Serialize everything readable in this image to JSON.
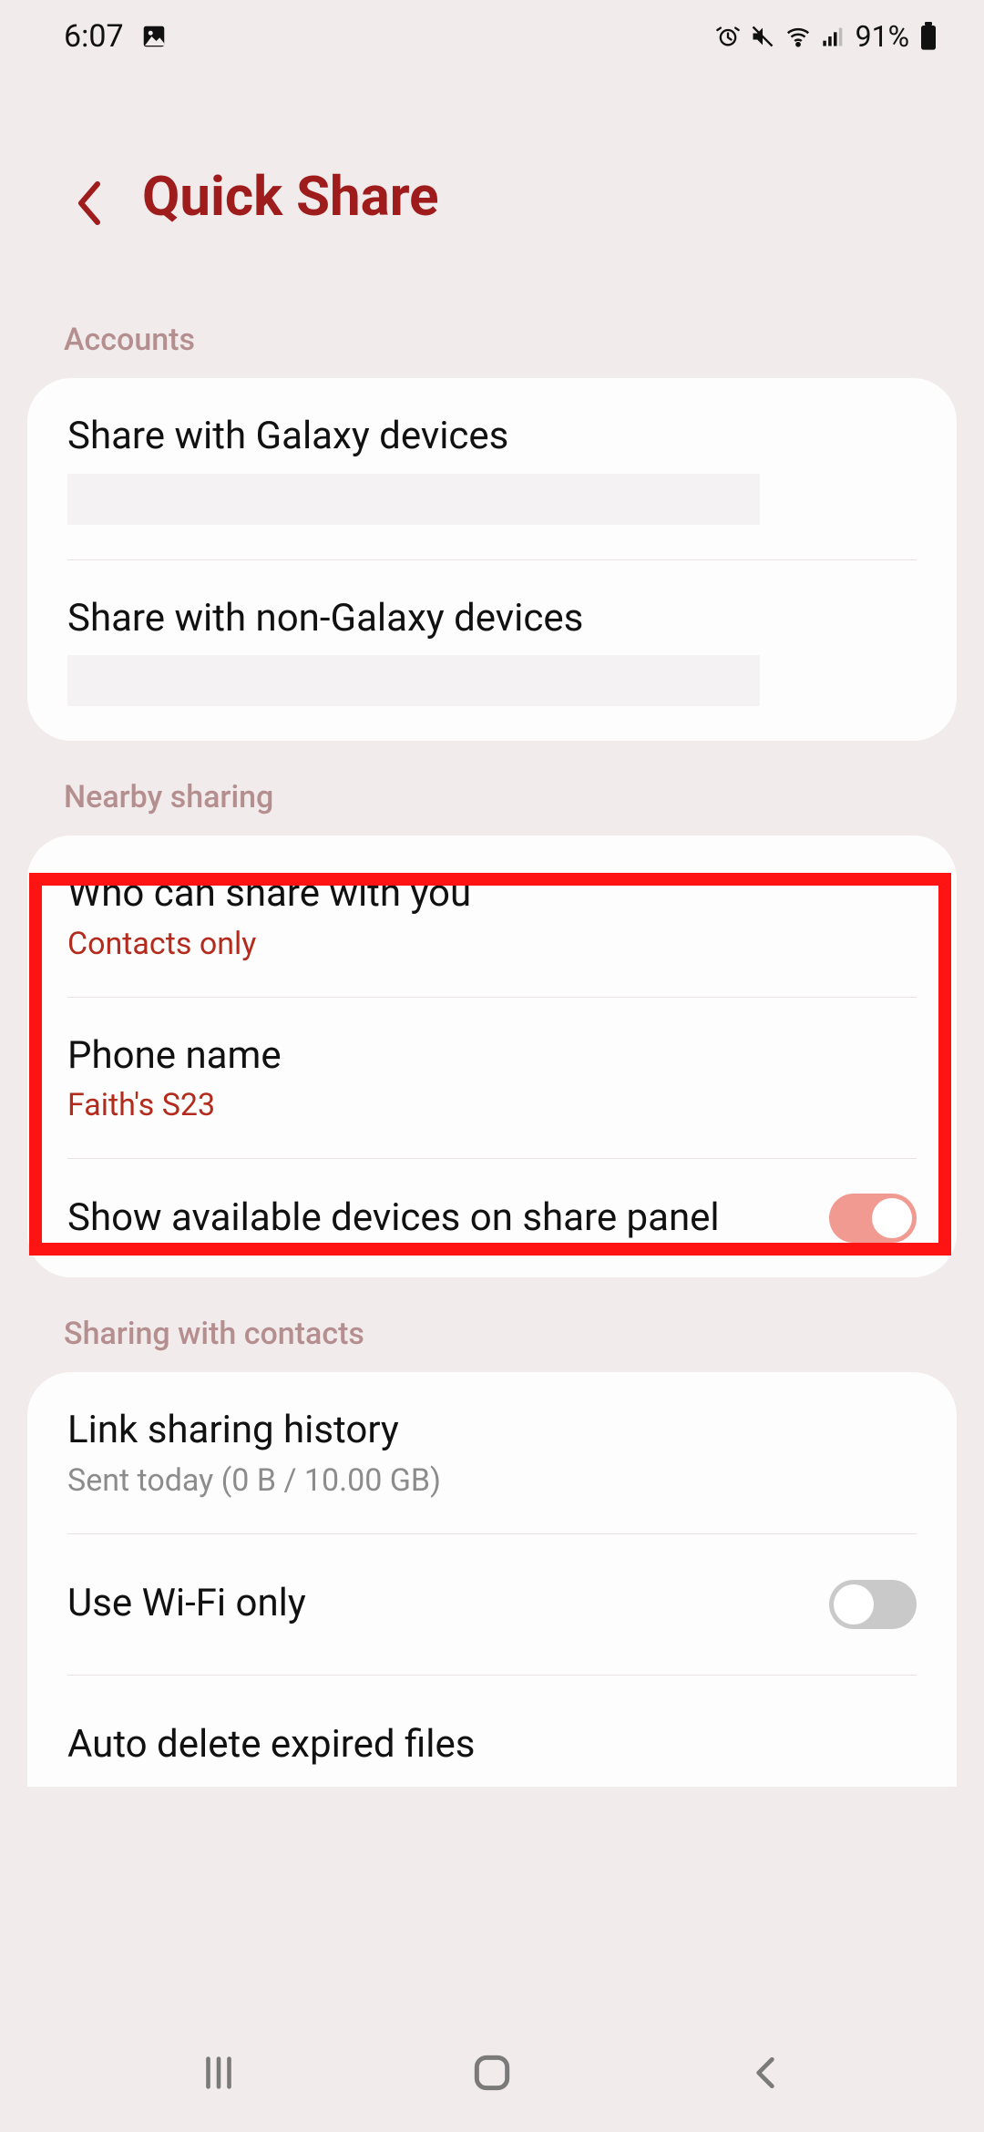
{
  "status": {
    "time": "6:07",
    "battery_pct": "91%"
  },
  "header": {
    "title": "Quick Share"
  },
  "sections": {
    "accounts": {
      "label": "Accounts",
      "galaxy_title": "Share with Galaxy devices",
      "non_galaxy_title": "Share with non-Galaxy devices"
    },
    "nearby": {
      "label": "Nearby sharing",
      "who_title": "Who can share with you",
      "who_value": "Contacts only",
      "phone_name_title": "Phone name",
      "phone_name_value": "Faith's S23",
      "show_devices_title": "Show available devices on share panel"
    },
    "contacts": {
      "label": "Sharing with contacts",
      "link_history_title": "Link sharing history",
      "link_history_sub": "Sent today (0 B / 10.00 GB)",
      "wifi_only_title": "Use Wi-Fi only",
      "auto_delete_title": "Auto delete expired files"
    }
  },
  "toggles": {
    "show_devices": true,
    "wifi_only": false
  }
}
